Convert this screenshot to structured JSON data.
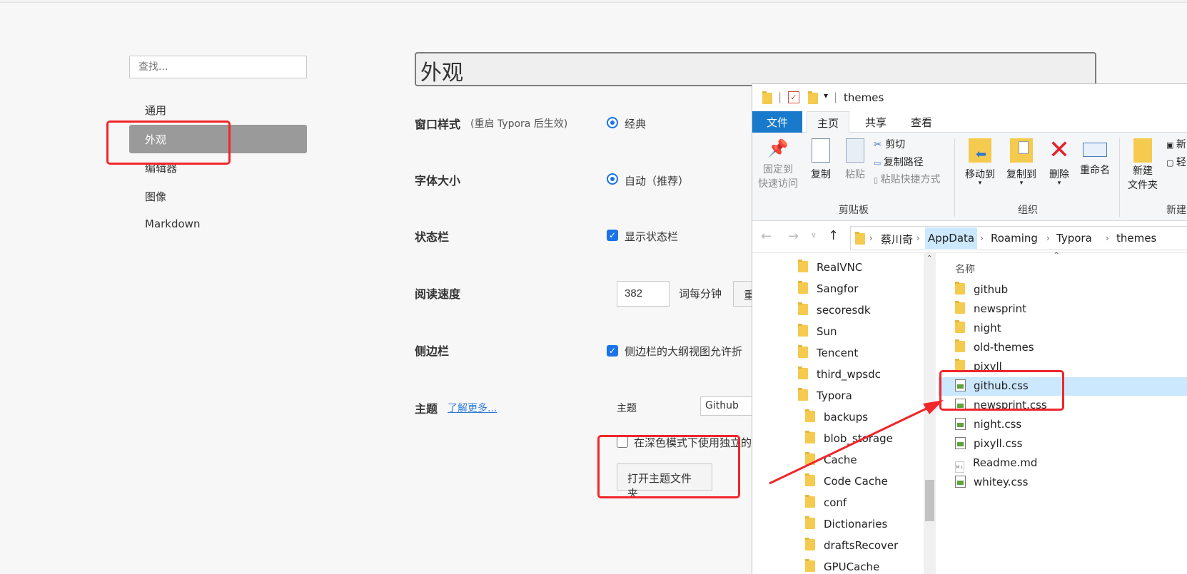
{
  "settings": {
    "search_placeholder": "查找...",
    "nav": [
      "通用",
      "外观",
      "编辑器",
      "图像",
      "Markdown"
    ],
    "page_title": "外观",
    "window_style": {
      "label": "窗口样式",
      "note": "(重启 Typora 后生效)",
      "option": "经典"
    },
    "font_size": {
      "label": "字体大小",
      "option": "自动（推荐）"
    },
    "status_bar": {
      "label": "状态栏",
      "option": "显示状态栏"
    },
    "reading_speed": {
      "label": "阅读速度",
      "value": "382",
      "unit": "词每分钟",
      "reset_partial": "重"
    },
    "sidebar": {
      "label": "侧边栏",
      "option": "侧边栏的大纲视图允许折"
    },
    "theme": {
      "label": "主题",
      "learn_more": "了解更多...",
      "select_label": "主题",
      "select_value": "Github",
      "dark_mode_option": "在深色模式下使用独立的",
      "open_folder": "打开主题文件夹"
    }
  },
  "explorer": {
    "title": "themes",
    "tabs": [
      "文件",
      "主页",
      "共享",
      "查看"
    ],
    "ribbon": {
      "pin": "固定到\n快速访问",
      "copy": "复制",
      "paste": "粘贴",
      "cut": "剪切",
      "copy_path": "复制路径",
      "paste_shortcut": "粘贴快捷方式",
      "clipboard_group": "剪贴板",
      "move_to": "移动到",
      "copy_to": "复制到",
      "delete": "删除",
      "rename": "重命名",
      "organize_group": "组织",
      "new_folder": "新建\n文件夹",
      "new_group": "新建",
      "new_item_partial": "新",
      "easy_access_partial": "轻"
    },
    "address": [
      "蔡川奇",
      "AppData",
      "Roaming",
      "Typora",
      "themes"
    ],
    "column_name": "名称",
    "nav_items": [
      "RealVNC",
      "Sangfor",
      "secoresdk",
      "Sun",
      "Tencent",
      "third_wpsdc",
      "Typora",
      "backups",
      "blob_storage",
      "Cache",
      "Code Cache",
      "conf",
      "Dictionaries",
      "draftsRecover",
      "GPUCache"
    ],
    "files": [
      {
        "name": "github",
        "kind": "folder"
      },
      {
        "name": "newsprint",
        "kind": "folder"
      },
      {
        "name": "night",
        "kind": "folder"
      },
      {
        "name": "old-themes",
        "kind": "folder"
      },
      {
        "name": "pixyll",
        "kind": "folder"
      },
      {
        "name": "github.css",
        "kind": "css"
      },
      {
        "name": "newsprint.css",
        "kind": "css"
      },
      {
        "name": "night.css",
        "kind": "css"
      },
      {
        "name": "pixyll.css",
        "kind": "css"
      },
      {
        "name": "Readme.md",
        "kind": "md"
      },
      {
        "name": "whitey.css",
        "kind": "css"
      }
    ]
  },
  "colors": {
    "annotation": "#f0262b",
    "accent": "#1a73e8",
    "selected_row": "#cce8ff",
    "file_tab": "#1979ca"
  }
}
